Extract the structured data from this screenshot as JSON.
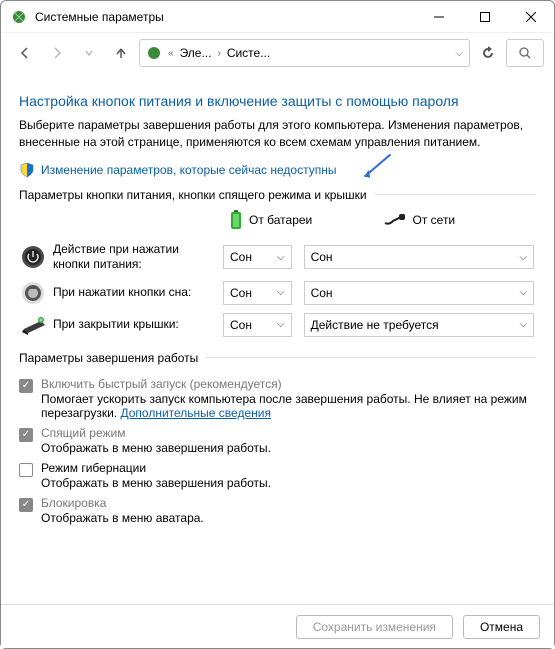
{
  "window": {
    "title": "Системные параметры"
  },
  "address": {
    "crumb1": "Эле...",
    "crumb2": "Систе..."
  },
  "main": {
    "heading": "Настройка кнопок питания и включение защиты с помощью пароля",
    "intro": "Выберите параметры завершения работы для этого компьютера. Изменения параметров, внесенные на этой странице, применяются ко всем схемам управления питанием.",
    "change_link": "Изменение параметров, которые сейчас недоступны",
    "section1": "Параметры кнопки питания, кнопки спящего режима и крышки",
    "col_battery": "От батареи",
    "col_ac": "От сети",
    "rows": {
      "power": {
        "label": "Действие при нажатии кнопки питания:",
        "battery": "Сон",
        "ac": "Сон"
      },
      "sleep": {
        "label": "При нажатии кнопки сна:",
        "battery": "Сон",
        "ac": "Сон"
      },
      "lid": {
        "label": "При закрытии крышки:",
        "battery": "Сон",
        "ac": "Действие не требуется"
      }
    },
    "section2": "Параметры завершения работы",
    "opts": {
      "faststart": {
        "title": "Включить быстрый запуск (рекомендуется)",
        "desc": "Помогает ускорить запуск компьютера после завершения работы. Не влияет на режим перезагрузки.",
        "more": "Дополнительные сведения"
      },
      "sleep": {
        "title": "Спящий режим",
        "desc": "Отображать в меню завершения работы."
      },
      "hiber": {
        "title": "Режим гибернации",
        "desc": "Отображать в меню завершения работы."
      },
      "lock": {
        "title": "Блокировка",
        "desc": "Отображать в меню аватара."
      }
    }
  },
  "footer": {
    "save": "Сохранить изменения",
    "cancel": "Отмена"
  }
}
